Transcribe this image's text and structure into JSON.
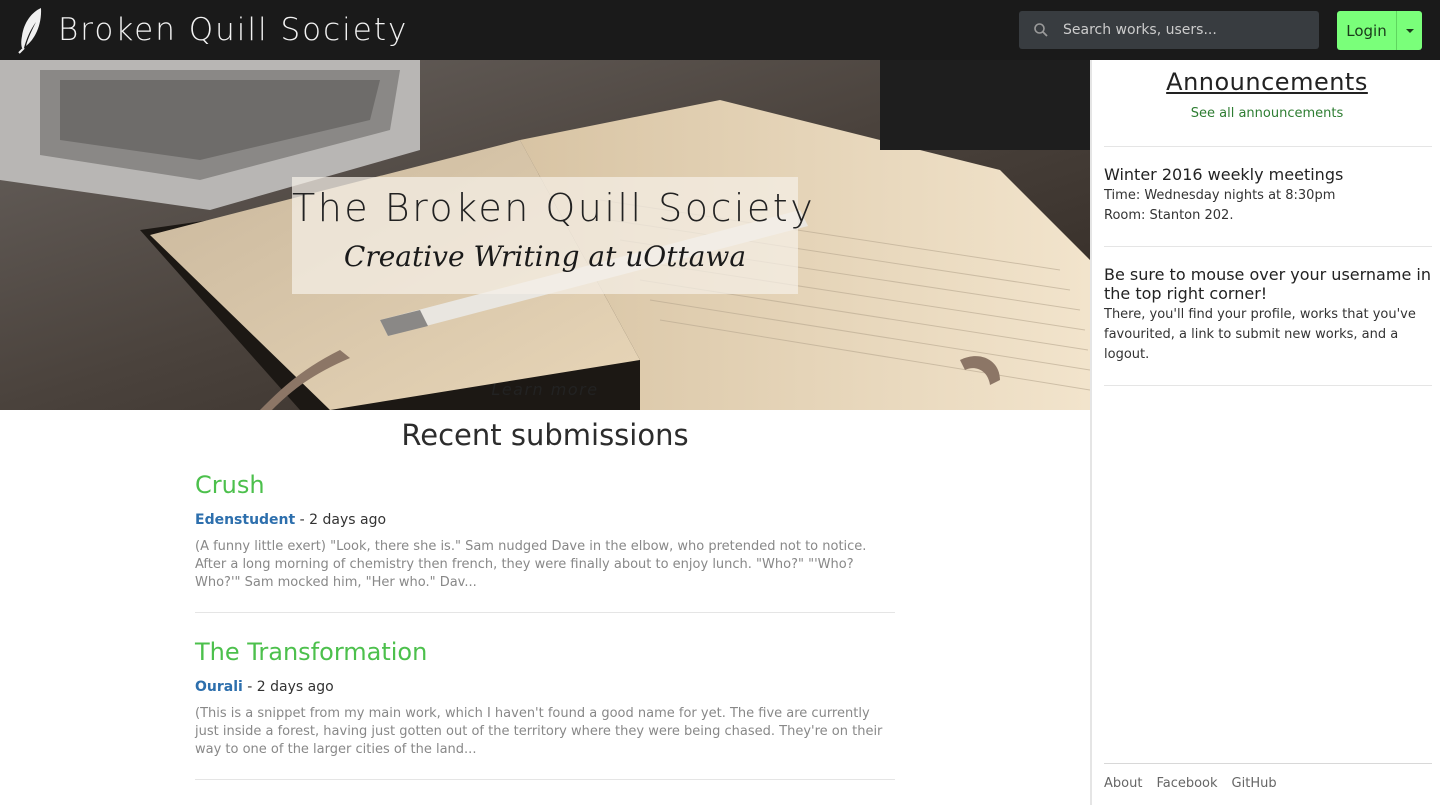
{
  "navbar": {
    "brand_title": "Broken Quill Society",
    "brand_icon": "quill-icon",
    "search_placeholder": "Search works, users...",
    "search_icon": "search-icon",
    "login_label": "Login",
    "login_caret_icon": "caret-down-icon",
    "colors": {
      "background": "#1a1a1a",
      "login_button": "#7aff7a"
    }
  },
  "hero": {
    "title": "The Broken Quill Society",
    "subtitle": "Creative Writing at uOttawa",
    "learn_more": "Learn more"
  },
  "main": {
    "section_title": "Recent submissions",
    "submissions": [
      {
        "title": "Crush",
        "author": "Edenstudent",
        "time": " - 2 days ago",
        "snippet": "(A funny little exert) \"Look, there she is.\" Sam nudged Dave in the elbow, who pretended not to notice. After a long morning of chemistry then french, they were finally about to enjoy lunch. \"Who?\" \"'Who? Who?'\" Sam mocked him, \"Her who.\" Dav..."
      },
      {
        "title": "The Transformation",
        "author": "Ourali",
        "time": " - 2 days ago",
        "snippet": "(This is a snippet from my main work, which I haven't found a good name for yet. The five are currently just inside a forest, having just gotten out of the territory where they were being chased. They're on their way to one of the larger cities of the land..."
      }
    ],
    "colors": {
      "title": "#4cc04c",
      "author": "#2d6fad"
    }
  },
  "sidebar": {
    "title": "Announcements",
    "see_all": "See all announcements",
    "items": [
      {
        "title": "Winter 2016 weekly meetings",
        "body_lines": [
          "Time: Wednesday nights at 8:30pm",
          "Room: Stanton 202."
        ]
      },
      {
        "title": "Be sure to mouse over your username in the top right corner!",
        "body_lines": [
          "There, you'll find your profile, works that you've favourited, a link to submit new works, and a logout."
        ]
      }
    ],
    "footer_links": [
      "About",
      "Facebook",
      "GitHub"
    ]
  }
}
